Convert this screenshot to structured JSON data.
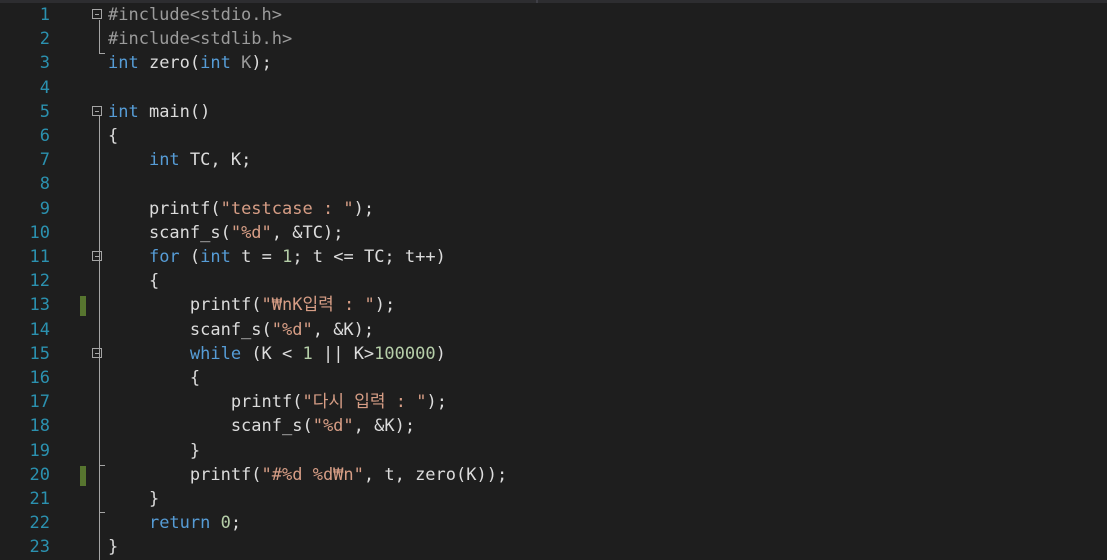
{
  "lines": [
    {
      "n": "1",
      "changed": false,
      "fold": true,
      "tokens": [
        {
          "t": "pp",
          "v": "#include<stdio.h>"
        }
      ]
    },
    {
      "n": "2",
      "changed": false,
      "fold": false,
      "tokens": [
        {
          "t": "pp",
          "v": "#include<stdlib.h>"
        }
      ]
    },
    {
      "n": "3",
      "changed": false,
      "fold": false,
      "tokens": [
        {
          "t": "kw",
          "v": "int"
        },
        {
          "t": "p",
          "v": " zero("
        },
        {
          "t": "kw",
          "v": "int"
        },
        {
          "t": "pm",
          "v": " K"
        },
        {
          "t": "p",
          "v": ");"
        }
      ]
    },
    {
      "n": "4",
      "changed": false,
      "fold": false,
      "tokens": []
    },
    {
      "n": "5",
      "changed": false,
      "fold": true,
      "tokens": [
        {
          "t": "kw",
          "v": "int"
        },
        {
          "t": "p",
          "v": " main()"
        }
      ]
    },
    {
      "n": "6",
      "changed": false,
      "fold": false,
      "tokens": [
        {
          "t": "p",
          "v": "{"
        }
      ]
    },
    {
      "n": "7",
      "changed": false,
      "fold": false,
      "tokens": [
        {
          "t": "p",
          "v": "    "
        },
        {
          "t": "kw",
          "v": "int"
        },
        {
          "t": "p",
          "v": " TC, K;"
        }
      ]
    },
    {
      "n": "8",
      "changed": false,
      "fold": false,
      "tokens": []
    },
    {
      "n": "9",
      "changed": false,
      "fold": false,
      "tokens": [
        {
          "t": "p",
          "v": "    printf("
        },
        {
          "t": "str",
          "v": "\"testcase : \""
        },
        {
          "t": "p",
          "v": ");"
        }
      ]
    },
    {
      "n": "10",
      "changed": false,
      "fold": false,
      "tokens": [
        {
          "t": "p",
          "v": "    scanf_s("
        },
        {
          "t": "str",
          "v": "\"%d\""
        },
        {
          "t": "p",
          "v": ", &TC);"
        }
      ]
    },
    {
      "n": "11",
      "changed": false,
      "fold": true,
      "tokens": [
        {
          "t": "p",
          "v": "    "
        },
        {
          "t": "kw",
          "v": "for"
        },
        {
          "t": "p",
          "v": " ("
        },
        {
          "t": "kw",
          "v": "int"
        },
        {
          "t": "p",
          "v": " t = "
        },
        {
          "t": "num",
          "v": "1"
        },
        {
          "t": "p",
          "v": "; t <= TC; t++)"
        }
      ]
    },
    {
      "n": "12",
      "changed": false,
      "fold": false,
      "tokens": [
        {
          "t": "p",
          "v": "    {"
        }
      ]
    },
    {
      "n": "13",
      "changed": true,
      "fold": false,
      "tokens": [
        {
          "t": "p",
          "v": "        printf("
        },
        {
          "t": "str",
          "v": "\"₩nK입력 : \""
        },
        {
          "t": "p",
          "v": ");"
        }
      ]
    },
    {
      "n": "14",
      "changed": false,
      "fold": false,
      "tokens": [
        {
          "t": "p",
          "v": "        scanf_s("
        },
        {
          "t": "str",
          "v": "\"%d\""
        },
        {
          "t": "p",
          "v": ", &K);"
        }
      ]
    },
    {
      "n": "15",
      "changed": false,
      "fold": true,
      "tokens": [
        {
          "t": "p",
          "v": "        "
        },
        {
          "t": "kw",
          "v": "while"
        },
        {
          "t": "p",
          "v": " (K < "
        },
        {
          "t": "num",
          "v": "1"
        },
        {
          "t": "p",
          "v": " || K>"
        },
        {
          "t": "num",
          "v": "100000"
        },
        {
          "t": "p",
          "v": ")"
        }
      ]
    },
    {
      "n": "16",
      "changed": false,
      "fold": false,
      "tokens": [
        {
          "t": "p",
          "v": "        {"
        }
      ]
    },
    {
      "n": "17",
      "changed": false,
      "fold": false,
      "tokens": [
        {
          "t": "p",
          "v": "            printf("
        },
        {
          "t": "str",
          "v": "\"다시 입력 : \""
        },
        {
          "t": "p",
          "v": ");"
        }
      ]
    },
    {
      "n": "18",
      "changed": false,
      "fold": false,
      "tokens": [
        {
          "t": "p",
          "v": "            scanf_s("
        },
        {
          "t": "str",
          "v": "\"%d\""
        },
        {
          "t": "p",
          "v": ", &K);"
        }
      ]
    },
    {
      "n": "19",
      "changed": false,
      "fold": false,
      "tokens": [
        {
          "t": "p",
          "v": "        }"
        }
      ]
    },
    {
      "n": "20",
      "changed": true,
      "fold": false,
      "tokens": [
        {
          "t": "p",
          "v": "        printf("
        },
        {
          "t": "str",
          "v": "\"#%d %d₩n\""
        },
        {
          "t": "p",
          "v": ", t, zero(K));"
        }
      ]
    },
    {
      "n": "21",
      "changed": false,
      "fold": false,
      "tokens": [
        {
          "t": "p",
          "v": "    }"
        }
      ]
    },
    {
      "n": "22",
      "changed": false,
      "fold": false,
      "tokens": [
        {
          "t": "p",
          "v": "    "
        },
        {
          "t": "kw",
          "v": "return"
        },
        {
          "t": "p",
          "v": " "
        },
        {
          "t": "num",
          "v": "0"
        },
        {
          "t": "p",
          "v": ";"
        }
      ]
    },
    {
      "n": "23",
      "changed": false,
      "fold": false,
      "tokens": [
        {
          "t": "p",
          "v": "}"
        }
      ]
    }
  ],
  "colors": {
    "background": "#1e1e1e",
    "line_number": "#2b91af",
    "keyword": "#569cd6",
    "string": "#d69d85",
    "number": "#b5cea8",
    "preprocessor": "#9b9b9b",
    "change_marker": "#57752f"
  }
}
